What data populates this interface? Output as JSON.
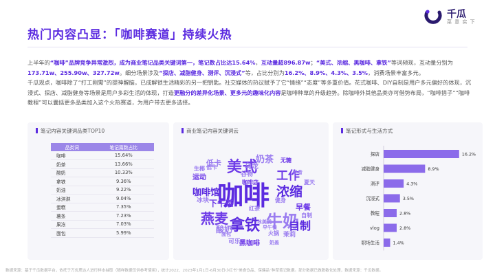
{
  "header": {
    "title": "热门内容凸显：「咖啡赛道」持续火热",
    "logo_name": "千瓜",
    "logo_sub": "菜 意 实 下"
  },
  "colors": {
    "accent": "#5b2be0",
    "bar": "#8b6bea",
    "table_header": "#9b86e8"
  },
  "paragraph": {
    "s1": "上半年的",
    "s2": "“咖啡”",
    "s3": "品牌竞争异常激烈，",
    "s4": "成为商业笔记品类关键词第一，",
    "s5": "笔记数占比达15.64%",
    "s6": "，",
    "s7": "互动量超896.87w",
    "s8": "；",
    "s9": "“美式、浓缩、黑咖啡、拿铁”",
    "s10": "等词频现，互动量分别为",
    "s11": "173.71w、255.90w、327.72w",
    "s12": "。细分场景涉及",
    "s13": "“探店、减脂健身、测评、沉浸式”",
    "s14": "等，占比分别为",
    "s15": "16.2%、8.9%、4.3%、3.5%",
    "s16": "，消费场景丰富多元。",
    "s17": "千瓜观点，咖啡除了“打工刚需”的提神醒脑，已成解锁生活精彩的另一把钥匙。社交媒体的热议赋予了它“情绪”“态度”等多重价值。花式咖啡、DIY自制是用户多元偏好的体现，沉浸式、探店、减脂健身等场景是用户多彩生活的体现，打造",
    "s18": "更融分的差异化场景、更多元的趣味化内容",
    "s19": "是咖啡种草的升级趋势。除咖啡外其他品类亦可借势布局，“咖啡搭子”“咖啡教程”可以囊括更多品类加入这个火热赛道，为用户带去更多选择。"
  },
  "table_panel": {
    "title": "笔记内容关键词品类TOP10",
    "headers": [
      "品类词",
      "笔记篇数占比"
    ],
    "rows": [
      [
        "咖啡",
        "15.64%"
      ],
      [
        "奶茶",
        "13.66%"
      ],
      [
        "酸奶",
        "10.33%"
      ],
      [
        "拿铁",
        "9.36%"
      ],
      [
        "奶油",
        "9.22%"
      ],
      [
        "冰淇淋",
        "9.04%"
      ],
      [
        "蛋糕",
        "7.35%"
      ],
      [
        "薯条",
        "7.23%"
      ],
      [
        "果冻",
        "7.03%"
      ],
      [
        "面包",
        "5.99%"
      ]
    ]
  },
  "cloud_panel": {
    "title": "商业笔记内容关键词云",
    "words": [
      {
        "t": "咖啡",
        "c": "#5b2be0"
      },
      {
        "t": "美式",
        "c": "#6f3ce8"
      },
      {
        "t": "拿铁",
        "c": "#5b2be0"
      },
      {
        "t": "牛奶",
        "c": "#9a7cf0"
      },
      {
        "t": "燕麦",
        "c": "#6f3ce8"
      },
      {
        "t": "浓缩",
        "c": "#5b2be0"
      },
      {
        "t": "工作",
        "c": "#6f3ce8"
      },
      {
        "t": "自制",
        "c": "#5b2be0"
      },
      {
        "t": "咖啡馆",
        "c": "#5b2be0"
      },
      {
        "t": "奶茶",
        "c": "#9a7cf0"
      },
      {
        "t": "下午茶",
        "c": "#6f3ce8"
      },
      {
        "t": "早餐",
        "c": "#6f3ce8"
      },
      {
        "t": "乌龙",
        "c": "#9a7cf0"
      },
      {
        "t": "运动",
        "c": "#6f3ce8"
      },
      {
        "t": "酸奶",
        "c": "#9a7cf0"
      },
      {
        "t": "低卡",
        "c": "#9a7cf0"
      },
      {
        "t": "冰块",
        "c": "#9a7cf0"
      },
      {
        "t": "黑咖啡",
        "c": "#6f3ce8"
      },
      {
        "t": "茉莉",
        "c": "#9a7cf0"
      },
      {
        "t": "红茶",
        "c": "#9a7cf0"
      },
      {
        "t": "谷物",
        "c": "#9a7cf0"
      },
      {
        "t": "无糖",
        "c": "#6f3ce8"
      },
      {
        "t": "生椰",
        "c": "#9a7cf0"
      },
      {
        "t": "健身",
        "c": "#9a7cf0"
      },
      {
        "t": "咖啡店",
        "c": "#6f3ce8"
      },
      {
        "t": "夏天",
        "c": "#9a7cf0"
      },
      {
        "t": "可乐",
        "c": "#9a7cf0"
      },
      {
        "t": "火锅",
        "c": "#9a7cf0"
      },
      {
        "t": "自制",
        "c": "#9a7cf0"
      },
      {
        "t": "低卡",
        "c": "#9a7cf0"
      },
      {
        "t": "面包",
        "c": "#9a7cf0"
      },
      {
        "t": "早午餐",
        "c": "#9a7cf0"
      },
      {
        "t": "奶盖",
        "c": "#9a7cf0"
      },
      {
        "t": "奶昔",
        "c": "#9a7cf0"
      },
      {
        "t": "冰美式",
        "c": "#9a7cf0"
      }
    ]
  },
  "chart_data": {
    "type": "bar",
    "title": "笔记形式与生活方式",
    "orientation": "horizontal",
    "categories": [
      "探店",
      "减脂健身",
      "测评",
      "沉浸式",
      "教程",
      "vlog",
      "职场生活"
    ],
    "values": [
      16.2,
      8.9,
      4.3,
      3.5,
      2.8,
      2.8,
      1.4
    ],
    "value_labels": [
      "16.2%",
      "8.9%",
      "4.3%",
      "3.5%",
      "2.8%",
      "2.8%",
      "1.4%"
    ],
    "xlim": [
      0,
      18
    ],
    "grid": false,
    "color": "#8b6bea"
  },
  "footer": "数据来源：基于千瓜数据平台，依托于万优质达人进行样本抽取（随样数据仅供参考使用），统计2022、2023年1月1日-6月30日小红书“美食饮品、保健品”种草笔记数据。部分数据已做脱敏化处理，数据来源：千瓜数据。"
}
